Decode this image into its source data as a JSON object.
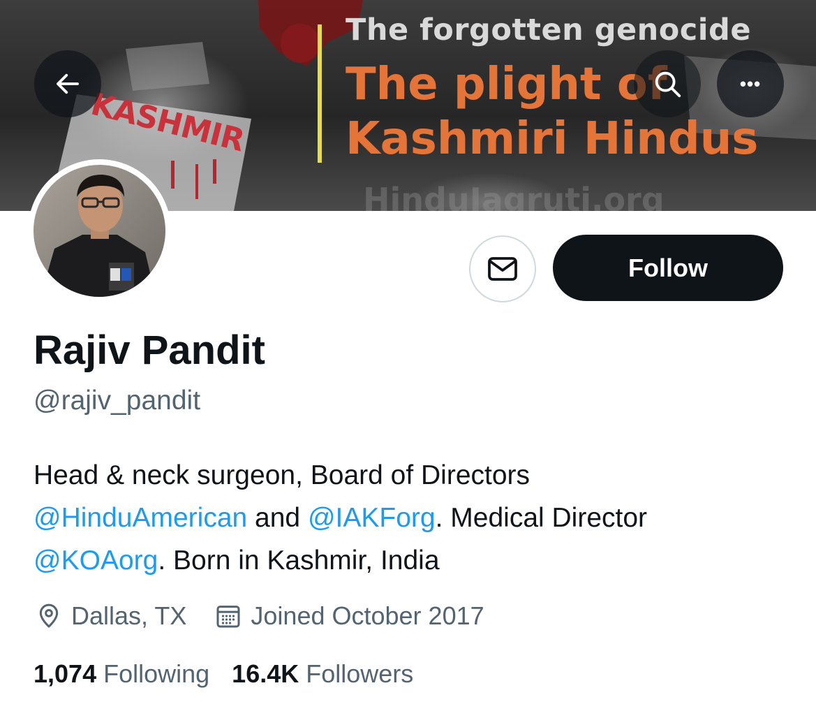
{
  "header": {
    "banner": {
      "title_top": "The forgotten genocide",
      "title_line1": "The plight of",
      "title_line2": "Kashmiri Hindus",
      "sign_text": "KASHMIR",
      "accent_color": "#e57439",
      "divider_color": "#e7dc4e"
    },
    "back_icon": "arrow-left-icon",
    "search_icon": "search-icon",
    "more_label": "•••"
  },
  "profile": {
    "avatar_icon": "profile-photo",
    "name": "Rajiv Pandit",
    "handle": "@rajiv_pandit",
    "bio": {
      "line1": "Head & neck surgeon, Board of Directors",
      "mention1": "@HinduAmerican",
      "and": " and ",
      "mention2": "@IAKForg",
      "medical_director": ". Medical Director",
      "mention3": "@KOAorg",
      "born": ". Born in Kashmir, India"
    },
    "location": "Dallas, TX",
    "joined": "Joined October 2017",
    "following_count": "1,074",
    "following_label": "Following",
    "followers_count": "16.4K",
    "followers_label": "Followers"
  },
  "actions": {
    "message_icon": "envelope-icon",
    "follow_label": "Follow"
  },
  "colors": {
    "text": "#0f1419",
    "secondary": "#536471",
    "link": "#1d9bf0",
    "button": "#0f1419",
    "border": "#cfd9de"
  }
}
